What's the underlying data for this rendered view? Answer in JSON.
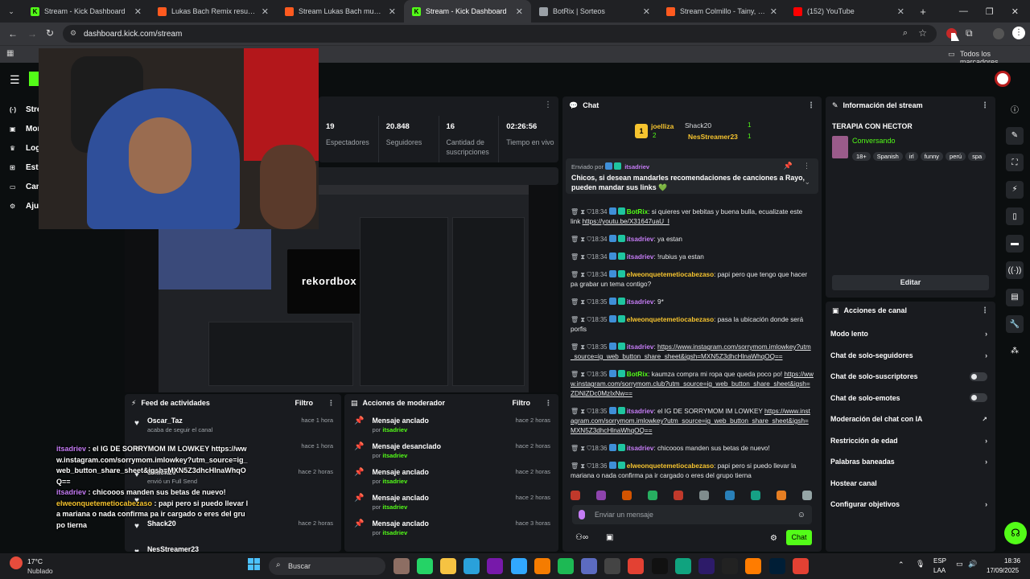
{
  "browser": {
    "tabs": [
      {
        "title": "Stream - Kick Dashboard",
        "color": "#53fc18",
        "glyph": "K",
        "active": false
      },
      {
        "title": "Lukas Bach Remix results on So",
        "color": "#ff5a1f",
        "glyph": "",
        "active": false
      },
      {
        "title": "Stream Lukas Bach music | Liste",
        "color": "#ff5a1f",
        "glyph": "",
        "active": false
      },
      {
        "title": "Stream - Kick Dashboard",
        "color": "#53fc18",
        "glyph": "K",
        "active": true
      },
      {
        "title": "BotRix | Sorteos",
        "color": "#9aa0a6",
        "glyph": "",
        "active": false
      },
      {
        "title": "Stream Colmillo - Tainy, J Balvi",
        "color": "#ff5a1f",
        "glyph": "",
        "active": false
      },
      {
        "title": "(152) YouTube",
        "color": "#ff0000",
        "glyph": "",
        "active": false
      }
    ],
    "new_tab": "+",
    "url": "dashboard.kick.com/stream",
    "bookmarks_label": "Todos los marcadores"
  },
  "sidebar": {
    "items": [
      {
        "label": "Stre",
        "icon": "broadcast-icon"
      },
      {
        "label": "Mon",
        "icon": "money-icon"
      },
      {
        "label": "Logr",
        "icon": "trophy-icon"
      },
      {
        "label": "Estu",
        "icon": "studio-icon"
      },
      {
        "label": "Can",
        "icon": "channel-icon"
      },
      {
        "label": "Ajus",
        "icon": "gear-icon"
      }
    ]
  },
  "stats": [
    {
      "value": "19",
      "label": "Espectadores"
    },
    {
      "value": "20.848",
      "label": "Seguidores"
    },
    {
      "value": "16",
      "label": "Cantidad de suscripciones"
    },
    {
      "value": "02:26:56",
      "label": "Tiempo en vivo"
    }
  ],
  "preview": {
    "logo_text": "rekordbox"
  },
  "activity_feed": {
    "title": "Feed de actividades",
    "filter": "Filtro",
    "items": [
      {
        "name": "Oscar_Taz",
        "sub": "acaba de seguir el canal",
        "time": "hace 1 hora"
      },
      {
        "name": "",
        "sub": "",
        "time": "hace 1 hora"
      },
      {
        "name": "Shack20",
        "sub": "envió un Full Send",
        "time": "hace 2 horas"
      },
      {
        "name": "",
        "sub": "",
        "time": ""
      },
      {
        "name": "Shack20",
        "sub": "",
        "time": "hace 2 horas"
      },
      {
        "name": "NesStreamer23",
        "sub": "",
        "time": ""
      }
    ]
  },
  "mod_actions": {
    "title": "Acciones de moderador",
    "filter": "Filtro",
    "items": [
      {
        "action": "Mensaje anclado",
        "by": "por",
        "user": "itsadriev",
        "time": "hace 2 horas"
      },
      {
        "action": "Mensaje desanclado",
        "by": "por",
        "user": "itsadriev",
        "time": "hace 2 horas"
      },
      {
        "action": "Mensaje anclado",
        "by": "por",
        "user": "itsadriev",
        "time": "hace 2 horas"
      },
      {
        "action": "Mensaje anclado",
        "by": "por",
        "user": "itsadriev",
        "time": "hace 2 horas"
      },
      {
        "action": "Mensaje anclado",
        "by": "por",
        "user": "itsadriev",
        "time": "hace 3 horas"
      }
    ]
  },
  "chat": {
    "title": "Chat",
    "top_gifters": [
      {
        "rank": "1",
        "name": "joelliza",
        "count": "2"
      },
      {
        "rank": "",
        "name": "Shack20",
        "count": "1"
      },
      {
        "rank": "",
        "name": "NesStreamer23",
        "count": "1"
      }
    ],
    "pinned": {
      "sent_by": "Enviado por",
      "user": "itsadriev",
      "text": "Chicos, si desean mandarles recomendaciones de canciones a Rayo, pueden mandar sus links 💚"
    },
    "messages": [
      {
        "time": "18:34",
        "user": "BotRix",
        "ucls": "u-green",
        "text": ": si quieres ver bebitas y buena bulla, ecualizate este link ",
        "link": "https://youtu.be/X31647uaU_I"
      },
      {
        "time": "18:34",
        "user": "itsadriev",
        "ucls": "u-purple",
        "text": ": ya estan",
        "link": ""
      },
      {
        "time": "18:34",
        "user": "itsadriev",
        "ucls": "u-purple",
        "text": ": !rubius ya estan",
        "link": ""
      },
      {
        "time": "18:34",
        "user": "elweonquetemetiocabezaso",
        "ucls": "u-yellow",
        "text": ": papi pero que tengo que hacer pa grabar un tema contigo?",
        "link": ""
      },
      {
        "time": "18:35",
        "user": "itsadriev",
        "ucls": "u-purple",
        "text": ": 9*",
        "link": ""
      },
      {
        "time": "18:35",
        "user": "elweonquetemetiocabezaso",
        "ucls": "u-yellow",
        "text": ": pasa la ubicación donde será porfis",
        "link": ""
      },
      {
        "time": "18:35",
        "user": "itsadriev",
        "ucls": "u-purple",
        "text": ": ",
        "link": "https://www.instagram.com/sorrymom.imlowkey?utm_source=ig_web_button_share_sheet&igsh=MXN5Z3dhcHlnaWhqOQ=="
      },
      {
        "time": "18:35",
        "user": "BotRix",
        "ucls": "u-green",
        "text": ": kaumza compra mi ropa que queda poco po! ",
        "link": "https://www.instagram.com/sorrymom.club?utm_source=ig_web_button_share_sheet&igsh=ZDNlZDc0MzIxNw=="
      },
      {
        "time": "18:35",
        "user": "itsadriev",
        "ucls": "u-purple",
        "text": ": el IG DE SORRYMOM IM LOWKEY ",
        "link": "https://www.instagram.com/sorrymom.imlowkey?utm_source=ig_web_button_share_sheet&igsh=MXN5Z3dhcHlnaWhqOQ=="
      },
      {
        "time": "18:36",
        "user": "itsadriev",
        "ucls": "u-purple",
        "text": ": chicooos manden sus betas de nuevo!",
        "link": ""
      },
      {
        "time": "18:36",
        "user": "elweonquetemetiocabezaso",
        "ucls": "u-yellow",
        "text": ": papi pero si puedo llevar la mariana o nada confirma pa ir cargado o eres del grupo tierna",
        "link": ""
      }
    ],
    "input_placeholder": "Enviar un mensaje",
    "send_label": "Chat"
  },
  "stream_info": {
    "title": "Información del stream",
    "stream_title": "TERAPIA CON HECTOR",
    "category": "Conversando",
    "tags": [
      "18+",
      "Spanish",
      "irl",
      "funny",
      "perú",
      "spa"
    ],
    "edit_label": "Editar"
  },
  "channel_actions": {
    "title": "Acciones de canal",
    "items": [
      {
        "label": "Modo lento",
        "control": "chevron"
      },
      {
        "label": "Chat de solo-seguidores",
        "control": "chevron"
      },
      {
        "label": "Chat de solo-suscriptores",
        "control": "toggle"
      },
      {
        "label": "Chat de solo-emotes",
        "control": "toggle"
      },
      {
        "label": "Moderación del chat con IA",
        "control": "external"
      },
      {
        "label": "Restricción de edad",
        "control": "chevron"
      },
      {
        "label": "Palabras baneadas",
        "control": "chevron"
      },
      {
        "label": "Hostear canal",
        "control": ""
      },
      {
        "label": "Configurar objetivos",
        "control": "chevron"
      }
    ]
  },
  "overlay_chat": [
    {
      "user": "itsadriev",
      "ucls": "u-purple",
      "text": " : el IG DE SORRYMOM IM LOWKEY https://www.instagram.com/sorrymom.imlowkey?utm_source=ig_web_button_share_sheet&igsh=MXN5Z3dhcHlnaWhqOQ=="
    },
    {
      "user": "itsadriev",
      "ucls": "u-purple",
      "text": " : chicooos manden sus betas de nuevo!"
    },
    {
      "user": "elweonquetemetiocabezaso",
      "ucls": "u-yellow",
      "text": " : papi pero si puedo llevar la mariana o nada confirma pa ir cargado o eres del grupo tierna"
    }
  ],
  "taskbar": {
    "weather_temp": "17°C",
    "weather_desc": "Nublado",
    "search_label": "Buscar",
    "lang_top": "ESP",
    "lang_bottom": "LAA",
    "time": "18:36",
    "date": "17/09/2025"
  },
  "colors": {
    "kick_green": "#53fc18",
    "panel": "#191b1f",
    "bg": "#0b0e0f"
  }
}
